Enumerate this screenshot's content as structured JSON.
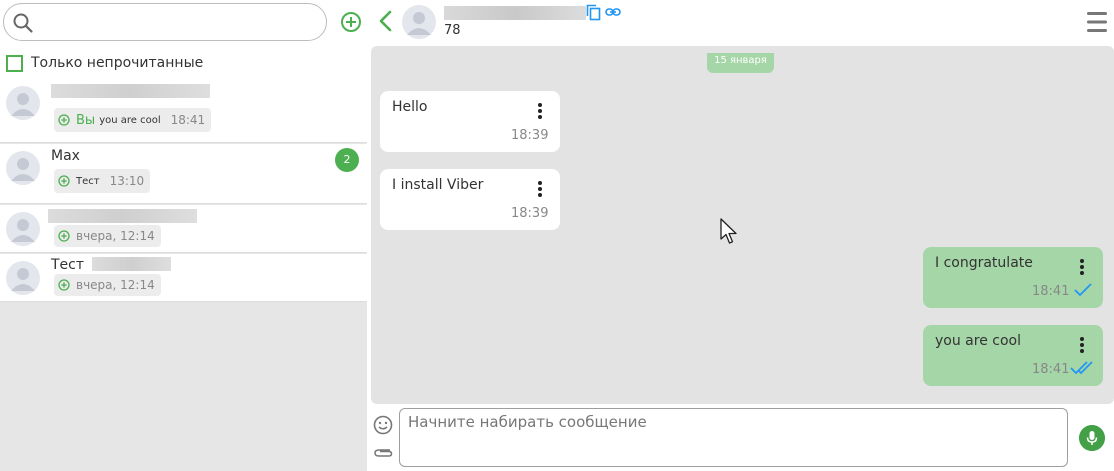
{
  "sidebar": {
    "search_placeholder": "",
    "unread_filter_label": "Только непрочитанные",
    "chats": [
      {
        "name": "",
        "preview_you": "Вы",
        "preview_text": "you are cool",
        "time": "18:41",
        "badge": ""
      },
      {
        "name": "Max",
        "preview_you": "",
        "preview_text": "Тест",
        "time": "13:10",
        "badge": "2"
      },
      {
        "name": "",
        "preview_you": "",
        "preview_text": "",
        "time": "вчера, 12:14",
        "badge": ""
      },
      {
        "name": "Тест",
        "preview_you": "",
        "preview_text": "",
        "time": "вчера, 12:14",
        "badge": ""
      }
    ]
  },
  "header": {
    "contact_subtitle": "78"
  },
  "conversation": {
    "date_label": "15 января",
    "messages": [
      {
        "direction": "in",
        "text": "Hello",
        "time": "18:39"
      },
      {
        "direction": "in",
        "text": "I install Viber",
        "time": "18:39"
      },
      {
        "direction": "out",
        "text": "I congratulate",
        "time": "18:41",
        "status": "delivered"
      },
      {
        "direction": "out",
        "text": "you are cool",
        "time": "18:41",
        "status": "read"
      }
    ]
  },
  "composer": {
    "placeholder": "Начните набирать сообщение"
  },
  "colors": {
    "accent": "#4caf50",
    "outgoing_bubble": "#a5d6a7",
    "check_blue": "#2196f3"
  },
  "icons": [
    "search-icon",
    "add-chat-icon",
    "back-icon",
    "copy-icon",
    "link-icon",
    "menu-icon",
    "kebab-icon",
    "emoji-icon",
    "attach-icon",
    "mic-icon"
  ]
}
